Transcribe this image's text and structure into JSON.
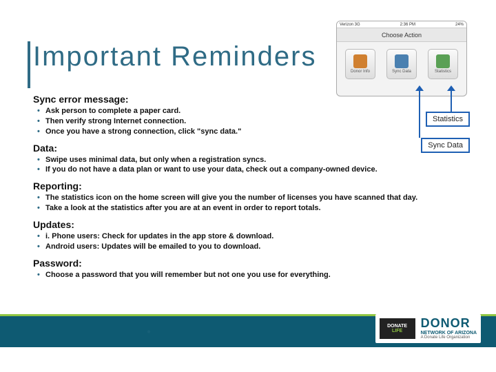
{
  "title": "Important Reminders",
  "sections": {
    "sync": {
      "heading": "Sync error message:",
      "items": [
        "Ask person to complete a paper card.",
        "Then verify strong Internet connection.",
        "Once you have a strong connection, click \"sync data.\""
      ]
    },
    "data": {
      "heading": "Data:",
      "items": [
        "Swipe uses minimal data, but only when a registration syncs.",
        "If you do not have a data plan or want to use your data, check out a company-owned device."
      ]
    },
    "reporting": {
      "heading": "Reporting:",
      "items": [
        "The statistics icon on the home screen will give you the number of licenses you have scanned that day.",
        "Take a look at the statistics after you are at an event in order to report totals."
      ]
    },
    "updates": {
      "heading": "Updates:",
      "items": [
        "i. Phone users: Check for updates in the app store & download.",
        "Android users: Updates will be emailed to you to download."
      ]
    },
    "password": {
      "heading": "Password:",
      "items": [
        "Choose a password that you will remember but not one you use for everything."
      ]
    }
  },
  "phone": {
    "status_left": "Verizon 3G",
    "status_center": "2:36 PM",
    "status_right": "24%",
    "header": "Choose Action",
    "icons": [
      "Donor Info",
      "Sync Data",
      "Statistics"
    ]
  },
  "callouts": {
    "statistics": "Statistics",
    "sync_data": "Sync Data"
  },
  "footer": {
    "donate_top": "DONATE",
    "donate_bottom": "LIFE",
    "donor_big": "DONOR",
    "donor_sub1": "NETWORK OF ARIZONA",
    "donor_sub2": "A Donate Life Organization"
  }
}
